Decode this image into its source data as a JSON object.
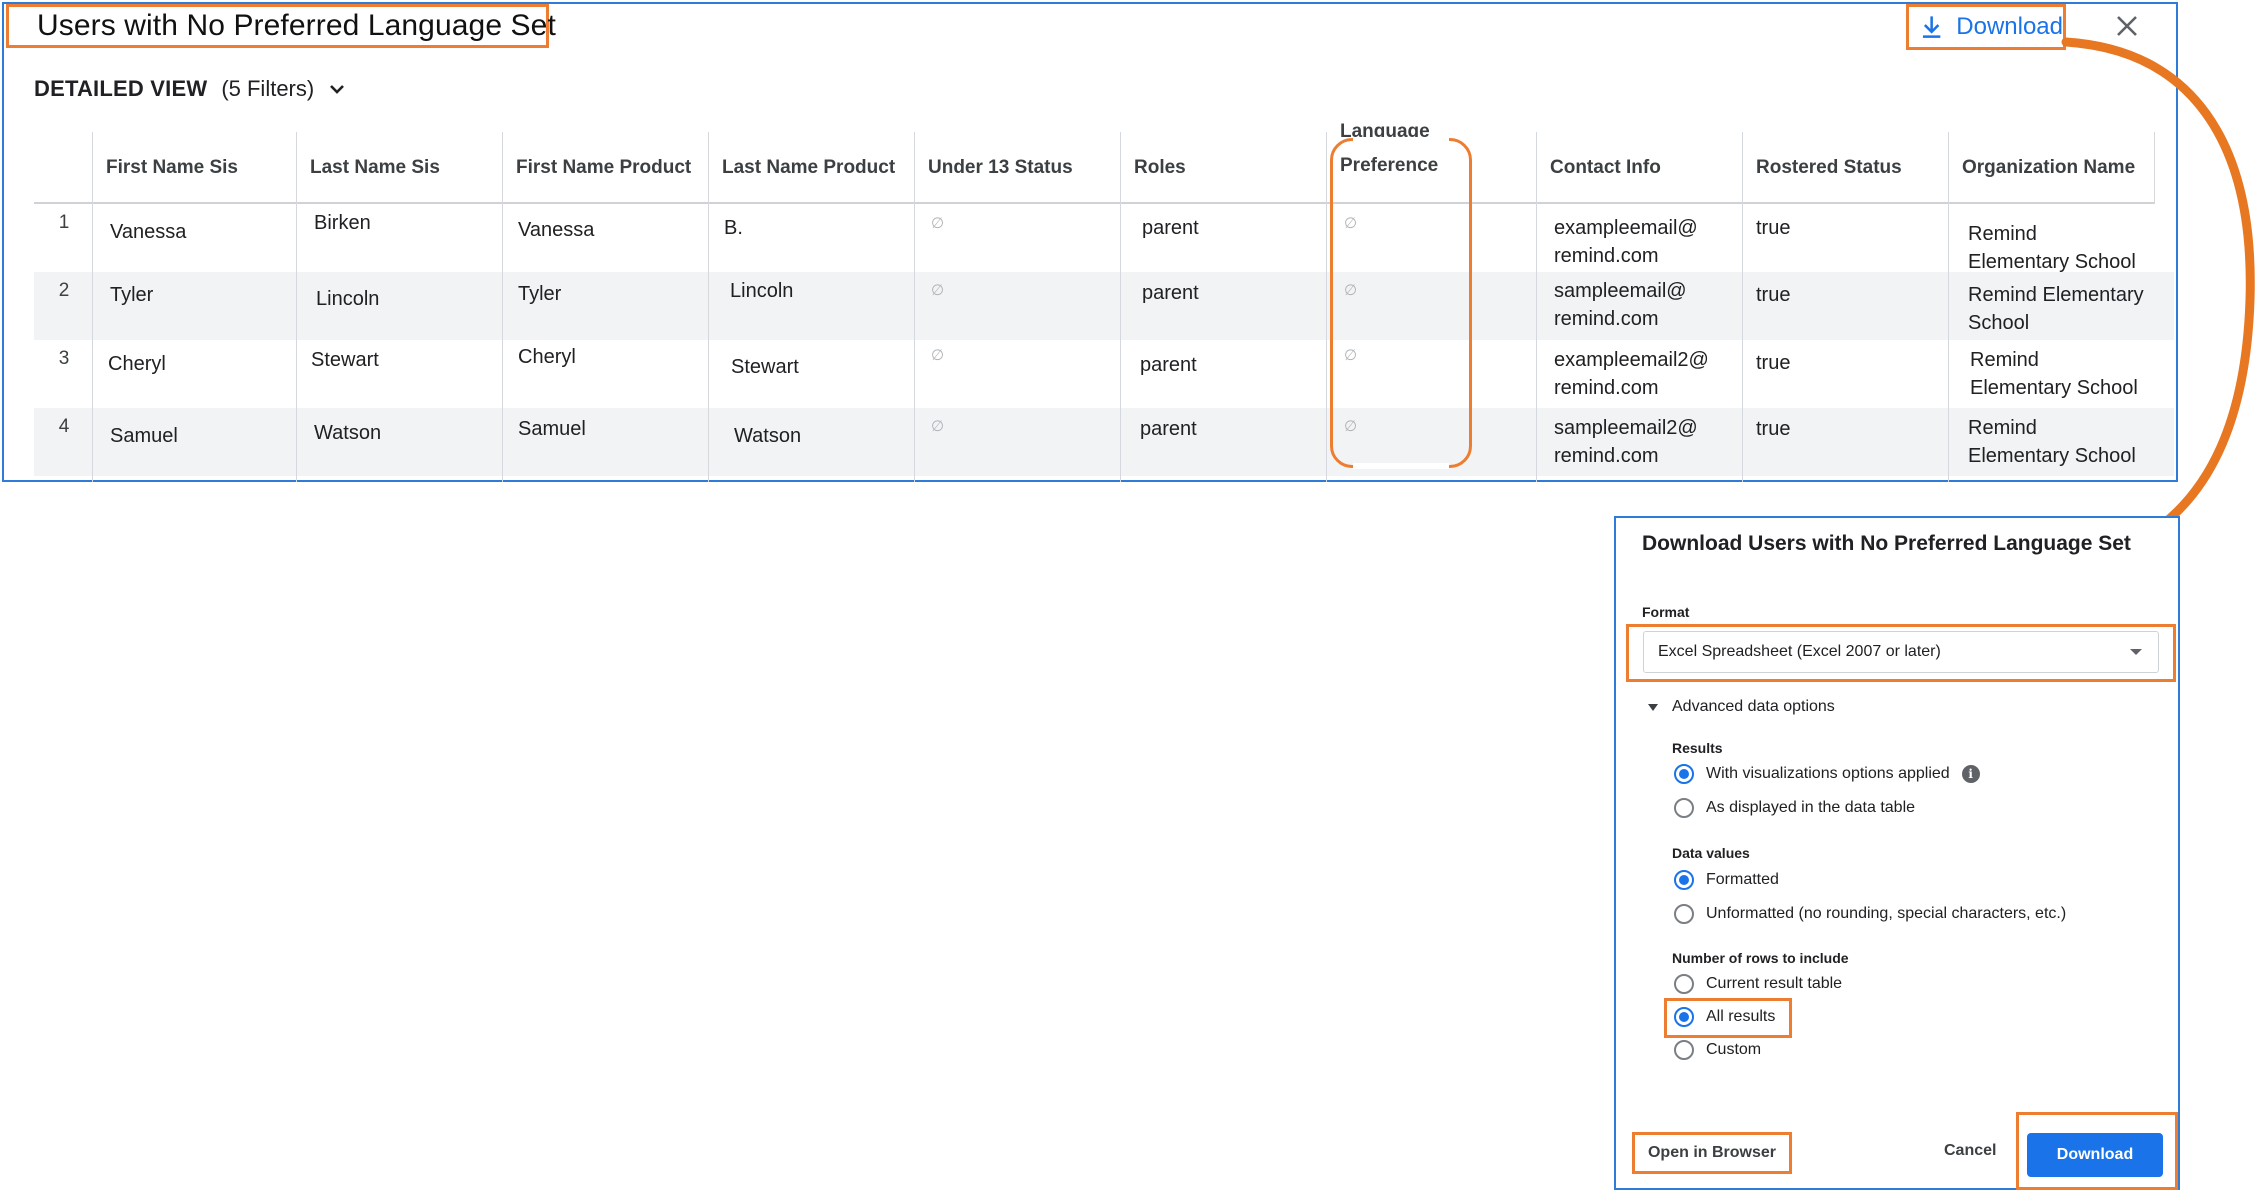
{
  "report": {
    "title": "Users with No Preferred Language Set",
    "download_label": "Download",
    "close_icon": "close-icon",
    "view_label": "DETAILED VIEW",
    "filters_label": "(5 Filters)"
  },
  "table": {
    "columns": [
      "First Name Sis",
      "Last Name Sis",
      "First Name Product",
      "Last Name Product",
      "Under 13 Status",
      "Roles",
      "Language",
      "Preference",
      "Contact Info",
      "Rostered Status",
      "Organization Name"
    ],
    "null_symbol": "∅",
    "rows": [
      {
        "num": "1",
        "first_sis": "Vanessa",
        "last_sis": "Birken",
        "first_prod": "Vanessa",
        "last_prod": "B.",
        "role": "parent",
        "contact_1": "exampleemail@",
        "contact_2": "remind.com",
        "rostered": "true",
        "org_1": "Remind",
        "org_2": "Elementary School"
      },
      {
        "num": "2",
        "first_sis": "Tyler",
        "last_sis": "Lincoln",
        "first_prod": "Tyler",
        "last_prod": "Lincoln",
        "role": "parent",
        "contact_1": "sampleemail@",
        "contact_2": "remind.com",
        "rostered": "true",
        "org_1": "Remind Elementary",
        "org_2": "School"
      },
      {
        "num": "3",
        "first_sis": "Cheryl",
        "last_sis": "Stewart",
        "first_prod": "Cheryl",
        "last_prod": "Stewart",
        "role": "parent",
        "contact_1": "exampleemail2@",
        "contact_2": "remind.com",
        "rostered": "true",
        "org_1": "Remind",
        "org_2": "Elementary School"
      },
      {
        "num": "4",
        "first_sis": "Samuel",
        "last_sis": "Watson",
        "first_prod": "Samuel",
        "last_prod": "Watson",
        "role": "parent",
        "contact_1": "sampleemail2@",
        "contact_2": "remind.com",
        "rostered": "true",
        "org_1": "Remind",
        "org_2": "Elementary School"
      }
    ]
  },
  "dialog": {
    "title": "Download Users with No Preferred Language Set",
    "format_label": "Format",
    "format_value": "Excel Spreadsheet (Excel 2007 or later)",
    "advanced_label": "Advanced data options",
    "results_label": "Results",
    "results_opt1": "With visualizations options applied",
    "results_opt2": "As displayed in the data table",
    "values_label": "Data values",
    "values_opt1": "Formatted",
    "values_opt2": "Unformatted (no rounding, special characters, etc.)",
    "rows_label": "Number of rows to include",
    "rows_opt1": "Current result table",
    "rows_opt2": "All results",
    "rows_opt3": "Custom",
    "open_browser": "Open in Browser",
    "cancel": "Cancel",
    "download": "Download",
    "info_glyph": "i"
  },
  "colors": {
    "highlight": "#ed7d31",
    "accent": "#1a73e8",
    "panel_border": "#2f7bd8"
  }
}
